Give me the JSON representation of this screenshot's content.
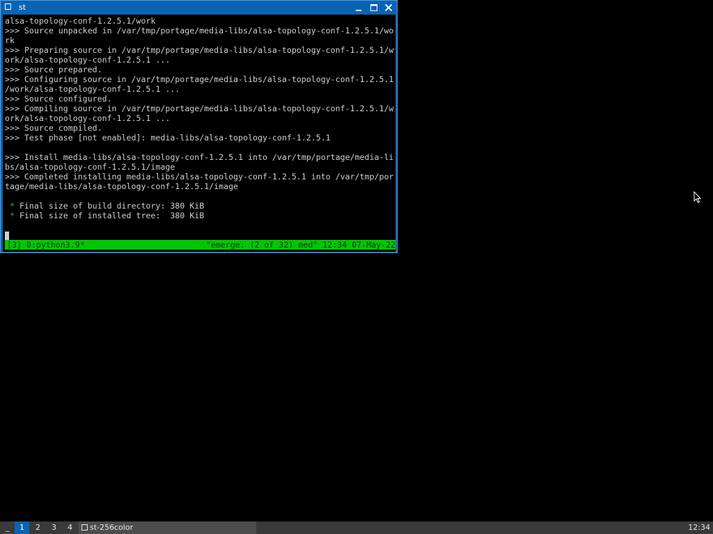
{
  "window": {
    "title": "st"
  },
  "terminal": {
    "lines": [
      {
        "text": "alsa-topology-conf-1.2.5.1/work"
      },
      {
        "text": ">>> Source unpacked in /var/tmp/portage/media-libs/alsa-topology-conf-1.2.5.1/wo"
      },
      {
        "text": "rk"
      },
      {
        "text": ">>> Preparing source in /var/tmp/portage/media-libs/alsa-topology-conf-1.2.5.1/w"
      },
      {
        "text": "ork/alsa-topology-conf-1.2.5.1 ..."
      },
      {
        "text": ">>> Source prepared."
      },
      {
        "text": ">>> Configuring source in /var/tmp/portage/media-libs/alsa-topology-conf-1.2.5.1"
      },
      {
        "text": "/work/alsa-topology-conf-1.2.5.1 ..."
      },
      {
        "text": ">>> Source configured."
      },
      {
        "text": ">>> Compiling source in /var/tmp/portage/media-libs/alsa-topology-conf-1.2.5.1/w"
      },
      {
        "text": "ork/alsa-topology-conf-1.2.5.1 ..."
      },
      {
        "text": ">>> Source compiled."
      },
      {
        "text": ">>> Test phase [not enabled]: media-libs/alsa-topology-conf-1.2.5.1"
      },
      {
        "text": ""
      },
      {
        "text": ">>> Install media-libs/alsa-topology-conf-1.2.5.1 into /var/tmp/portage/media-li"
      },
      {
        "text": "bs/alsa-topology-conf-1.2.5.1/image"
      },
      {
        "text": ">>> Completed installing media-libs/alsa-topology-conf-1.2.5.1 into /var/tmp/por"
      },
      {
        "text": "tage/media-libs/alsa-topology-conf-1.2.5.1/image"
      },
      {
        "text": ""
      },
      {
        "star": "*",
        "text": " Final size of build directory: 380 KiB"
      },
      {
        "star": "*",
        "text": " Final size of installed tree:  380 KiB"
      }
    ]
  },
  "statusbar": {
    "left": "[3] 0:python3.9*",
    "right": "\"emerge: (2 of 32) med\" 12:34 07-May-22"
  },
  "taskbar": {
    "menu_label": "_",
    "workspaces": [
      "1",
      "2",
      "3",
      "4"
    ],
    "active_workspace": "1",
    "task_label": "st-256color",
    "clock": "12:34"
  },
  "colors": {
    "titlebar": "#0a64b4",
    "terminal_bg": "#000000",
    "terminal_fg": "#cfcfcf",
    "statusbar_bg": "#00c800",
    "star": "#2fb82f",
    "taskbar_bg": "#3a3a3a"
  }
}
